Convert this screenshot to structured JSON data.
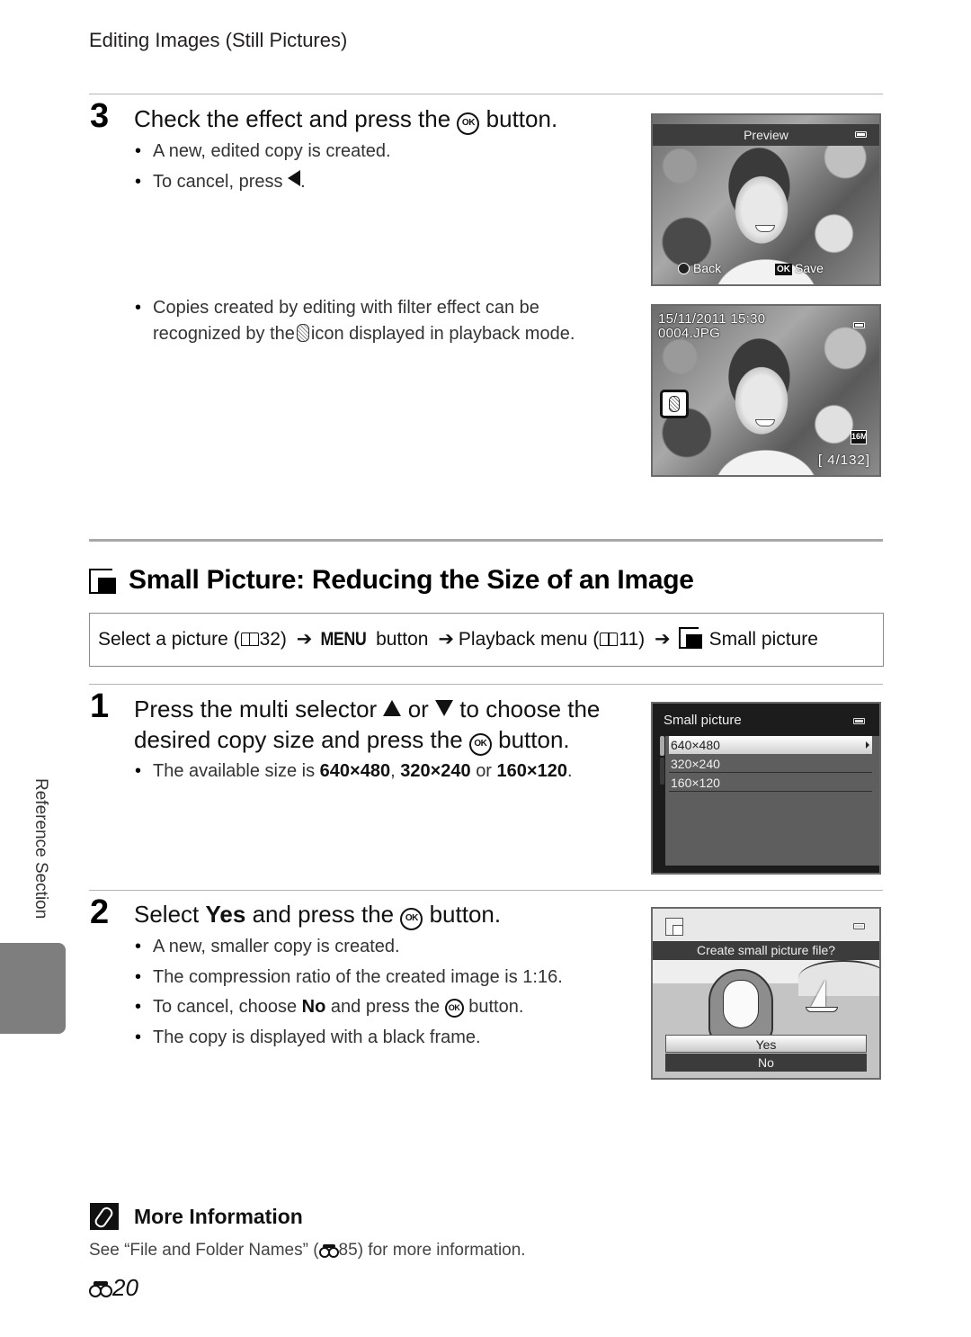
{
  "header": {
    "running_head": "Editing Images (Still Pictures)"
  },
  "step3": {
    "number": "3",
    "title_pre": "Check the effect and press the",
    "title_post": "button.",
    "bullets": [
      "A new, edited copy is created.",
      "To cancel, press"
    ],
    "note_line1": "Copies created by editing with filter effect can be",
    "note_line2_pre": "recognized by the",
    "note_line2_post": "icon displayed in playback mode."
  },
  "screen_preview": {
    "title": "Preview",
    "back_label": "Back",
    "ok_label": "OK",
    "save_label": "Save"
  },
  "screen_playback": {
    "datetime": "15/11/2011  15:30",
    "filename": "0004.JPG",
    "image_size_badge": "16M",
    "counter": "[   4/132]"
  },
  "section": {
    "title": "Small Picture: Reducing the Size of an Image",
    "path": {
      "part1": "Select a picture (",
      "ref1": "32)",
      "menu_word": "MENU",
      "part2": "button",
      "part3": "Playback menu (",
      "ref2": "11)",
      "part4": "Small picture"
    }
  },
  "step1": {
    "number": "1",
    "title_line1_pre": "Press the multi selector",
    "title_line1_mid": "or",
    "title_line1_post": "to choose the",
    "title_line2_pre": "desired copy size and press the",
    "title_line2_post": "button.",
    "bullet_pre": "The available size is",
    "sizes": [
      "640×480",
      "320×240",
      "160×120"
    ],
    "bullet_sep1": ",",
    "bullet_sep2": "or",
    "bullet_end": "."
  },
  "screen_small_picture": {
    "title": "Small picture",
    "options": [
      "640×480",
      "320×240",
      "160×120"
    ],
    "selected_index": 0
  },
  "step2": {
    "number": "2",
    "title_pre": "Select",
    "title_bold": "Yes",
    "title_mid": "and press the",
    "title_post": "button.",
    "bullets": [
      "A new, smaller copy is created.",
      "The compression ratio of the created image is 1:16."
    ],
    "cancel_pre": "To cancel, choose",
    "cancel_bold": "No",
    "cancel_mid": "and press the",
    "cancel_post": "button.",
    "last_bullet": "The copy is displayed with a black frame."
  },
  "screen_confirm": {
    "prompt": "Create small picture file?",
    "yes_label": "Yes",
    "no_label": "No"
  },
  "side_tab": {
    "label": "Reference Section"
  },
  "more_info": {
    "title": "More Information",
    "text_pre": "See “File and Folder Names” (",
    "ref": "85",
    "text_post": ") for more information."
  },
  "page_number": "20",
  "glyphs": {
    "ok": "OK",
    "size_badge": "16M"
  }
}
